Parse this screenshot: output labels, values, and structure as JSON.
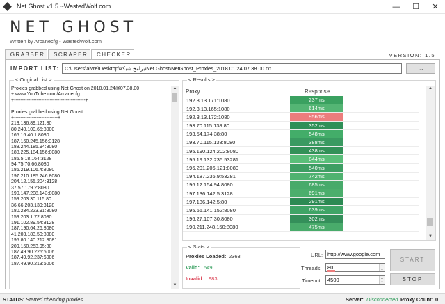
{
  "window": {
    "title": "Net Ghost v1.5 ~WastedWolf.com",
    "controls": [
      "—",
      "☐",
      "✕"
    ]
  },
  "header": {
    "brand": "NET GHOST",
    "subtitle": "Written by Arcanecfg - WastedWolf.com",
    "version": "VERSION: 1.5"
  },
  "tabs": [
    {
      "label": ".GRABBER",
      "active": false
    },
    {
      "label": ".SCRAPER",
      "active": false
    },
    {
      "label": ".CHECKER",
      "active": true
    }
  ],
  "import": {
    "label": "IMPORT LIST:",
    "path": "C:\\Users\\alvre\\Desktop\\برامج شبكة\\Net Ghost\\NetGhost_Proxies_2018.01.24 07.38.00.txt",
    "browse_label": "..."
  },
  "original_list": {
    "legend": "< Original List >",
    "lines": [
      "Proxies grabbed using Net Ghost on 2018.01.24@07.38.00",
      "+ www.YouTube.com/Arcanecfg",
      "+--------------------------------------------+",
      "",
      "Proxies grabbed using Net Ghost.",
      "+---------------------------+",
      "213.136.89.121:80",
      "80.240.100.65:8000",
      "165.16.40.1:8080",
      "187.160.245.156:3128",
      "188.244.185.94:8080",
      "188.225.184.156:8080",
      "185.5.18.164:3128",
      "94.75.70.66:8080",
      "186.219.106.4:8080",
      "197.210.185.246:8080",
      "204.12.155.204:3128",
      "37.57.179.2:8080",
      "190.147.208.143:8080",
      "159.203.30.115:80",
      "36.66.203.139:3128",
      "180.234.223.91:8080",
      "159.203.1.72:8080",
      "191.102.89.54:3128",
      "187.190.64.26:8080",
      "41.203.183.50:8080",
      "195.80.140.212:8081",
      "209.150.253.95:80",
      "187.49.90.225:6006",
      "187.49.92.237:6006",
      "187.49.90.213:6006"
    ]
  },
  "results": {
    "legend": "< Results >",
    "col_proxy": "Proxy",
    "col_response": "Response",
    "rows": [
      {
        "proxy": "192.3.13.171:1080",
        "response": "237ms",
        "color": "#3aa160"
      },
      {
        "proxy": "192.3.13.165:1080",
        "response": "614ms",
        "color": "#54b574"
      },
      {
        "proxy": "192.3.13.172:1080",
        "response": "956ms",
        "color": "#ec7d7d"
      },
      {
        "proxy": "193.70.115.138:80",
        "response": "352ms",
        "color": "#2f8f57"
      },
      {
        "proxy": "193.54.174.38:80",
        "response": "548ms",
        "color": "#43ad69"
      },
      {
        "proxy": "193.70.115.138:8080",
        "response": "388ms",
        "color": "#3a9a61"
      },
      {
        "proxy": "195.190.124.202:8080",
        "response": "438ms",
        "color": "#329158"
      },
      {
        "proxy": "195.19.132.235:53281",
        "response": "844ms",
        "color": "#59be79"
      },
      {
        "proxy": "196.201.206.121:8080",
        "response": "540ms",
        "color": "#3d9e63"
      },
      {
        "proxy": "194.187.236.9:53281",
        "response": "742ms",
        "color": "#4fb270"
      },
      {
        "proxy": "196.12.154.94:8080",
        "response": "685ms",
        "color": "#47aa6a"
      },
      {
        "proxy": "197.136.142.5:3128",
        "response": "691ms",
        "color": "#4bae6c"
      },
      {
        "proxy": "197.136.142.5:80",
        "response": "291ms",
        "color": "#2c8a53"
      },
      {
        "proxy": "195.66.141.152:8080",
        "response": "639ms",
        "color": "#3fa466"
      },
      {
        "proxy": "196.27.107.30:8080",
        "response": "302ms",
        "color": "#348f5a"
      },
      {
        "proxy": "190.211.248.150:8080",
        "response": "475ms",
        "color": "#49ab6b"
      }
    ]
  },
  "stats": {
    "legend": "< Stats >",
    "loaded_label": "Proxies Loaded:",
    "loaded": "2363",
    "valid_label": "Valid:",
    "valid": "549",
    "invalid_label": "Invalid:",
    "invalid": "983",
    "valid_color": "#2e9b59",
    "invalid_color": "#d9364a"
  },
  "settings": {
    "url_label": "URL:",
    "url": "http://www.google.com",
    "threads_label": "Threads:",
    "threads": "80",
    "timeout_label": "Timeout:",
    "timeout": "4500"
  },
  "buttons": {
    "start": "START",
    "stop": "STOP"
  },
  "statusbar": {
    "status_label": "STATUS:",
    "status_text": "Started checking proxies...",
    "server_label": "Server:",
    "server_value": "Disconnected",
    "server_color": "#2e9b59",
    "count_label": "Proxy Count:",
    "count": "0"
  }
}
